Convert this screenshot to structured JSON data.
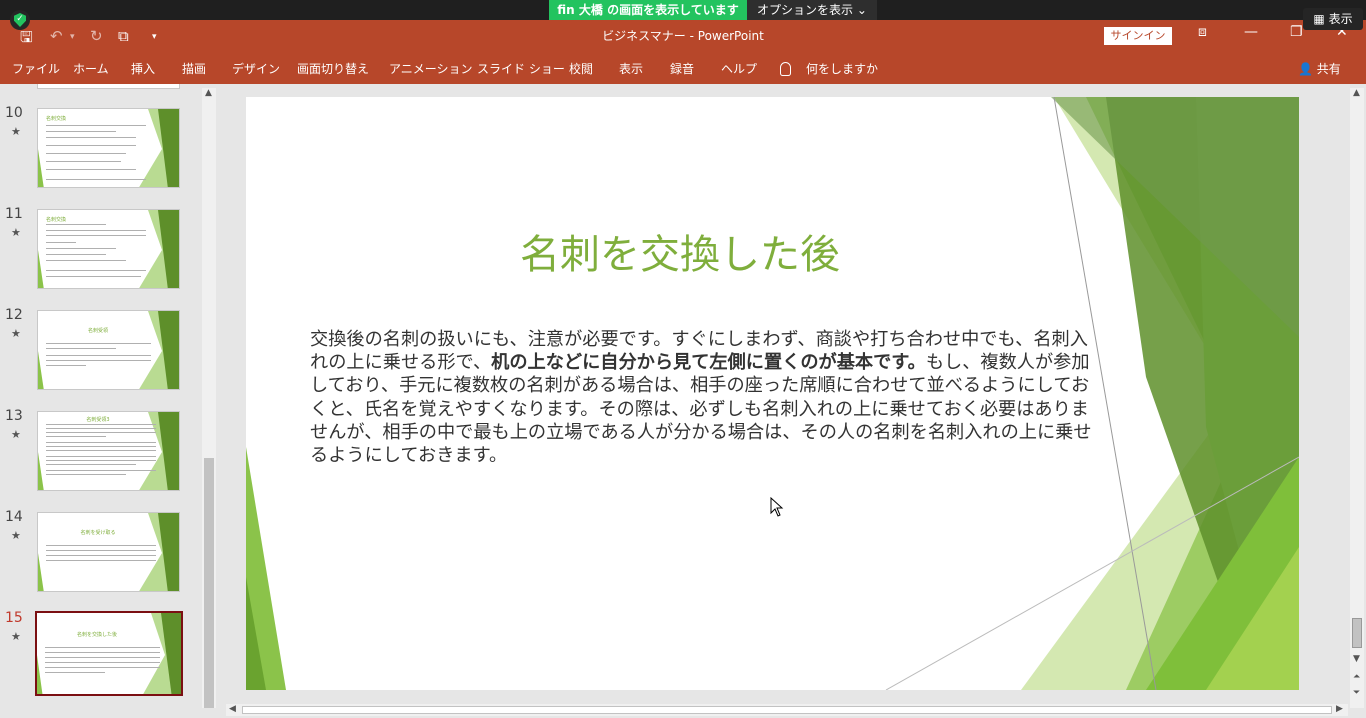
{
  "share_bar": {
    "sharing_text": "fin 大橋 の画面を表示しています",
    "options_label": "オプションを表示",
    "view_label": "表示"
  },
  "titlebar": {
    "document_title": "ビジネスマナー  -  PowerPoint",
    "signin_label": "サインイン"
  },
  "ribbon": {
    "tabs": [
      "ファイル",
      "ホーム",
      "挿入",
      "描画",
      "デザイン",
      "画面切り替え",
      "アニメーション",
      "スライド ショー",
      "校閲",
      "表示",
      "録音",
      "ヘルプ"
    ],
    "tell_me": "何をしますか",
    "share": "共有"
  },
  "thumbnails": [
    {
      "number": "10",
      "star": "★",
      "title": "名刺交換"
    },
    {
      "number": "11",
      "star": "★",
      "title": "名刺交換"
    },
    {
      "number": "12",
      "star": "★",
      "title": "名刺受領"
    },
    {
      "number": "13",
      "star": "★",
      "title": "名刺受領3"
    },
    {
      "number": "14",
      "star": "★",
      "title": "名刺を受け取る"
    },
    {
      "number": "15",
      "star": "★",
      "title": "名刺を交換した後",
      "active": true
    }
  ],
  "slide": {
    "title": "名刺を交換した後",
    "body_part1": "交換後の名刺の扱いにも、注意が必要です。すぐにしまわず、商談や打ち合わせ中でも、名刺入れの上に乗せる形で、",
    "body_bold": "机の上などに自分から見て左側に置くのが基本です。",
    "body_part2": "もし、複数人が参加しており、手元に複数枚の名刺がある場合は、相手の座った席順に合わせて並べるようにしておくと、氏名を覚えやすくなります。その際は、必ずしも名刺入れの上に乗せておく必要はありませんが、相手の中で最も上の立場である人が分かる場合は、その人の名刺を名刺入れの上に乗せるようにしておきます。"
  },
  "colors": {
    "title_bar": "#b7472a",
    "accent_green": "#7fae3c",
    "share_green": "#23c35f",
    "active_thumb_border": "#7b0f12"
  }
}
